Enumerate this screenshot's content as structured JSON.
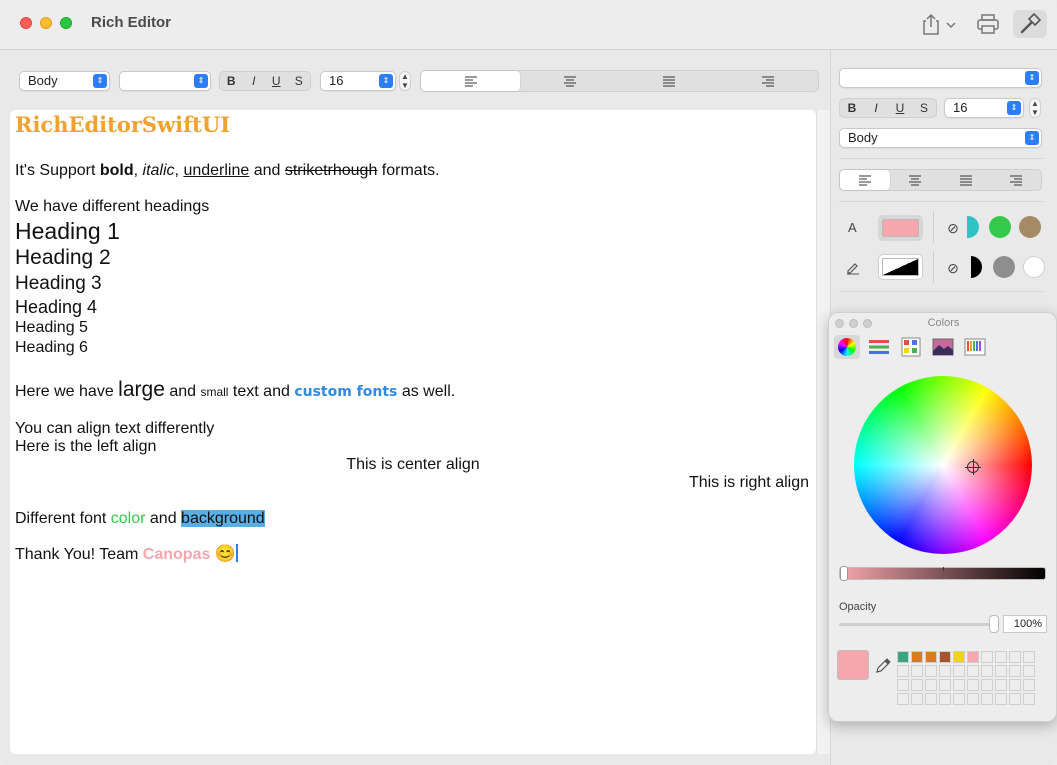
{
  "window": {
    "title": "Rich Editor"
  },
  "toolbar": {
    "style_popup": "Body",
    "font_popup": "",
    "bold": "B",
    "italic": "I",
    "underline": "U",
    "strike": "S",
    "size": "16",
    "align": [
      "left",
      "center",
      "justify",
      "right"
    ],
    "selected_align": "left"
  },
  "editor": {
    "title": "RichEditorSwiftUI",
    "support_prefix": "It's Support ",
    "bold_word": "bold",
    "comma1": ", ",
    "italic_word": "italic",
    "comma2": ", ",
    "underline_word": "underline",
    "and1": " and ",
    "strike_word": "striketrhough",
    "formats_suffix": " formats.",
    "headings_intro": "We have different headings",
    "headings": [
      "Heading 1",
      "Heading 2",
      "Heading 3",
      "Heading 4",
      "Heading 5",
      "Heading 6"
    ],
    "size_prefix": "Here we have ",
    "large_word": "large",
    "and2": " and ",
    "small_word": "small",
    "text_and": " text and ",
    "custom_fonts": "custom fonts",
    "as_well": " as well.",
    "align_intro": "You can align text differently",
    "left_align": "Here is the left align",
    "center_align": "This is center align",
    "right_align": "This is right align",
    "diff_font": "Different font ",
    "color_word": "color",
    "and3": " and ",
    "background_word": "background",
    "thanks": "Thank You! Team ",
    "canopas": "Canopas",
    "emoji": "😊"
  },
  "inspector": {
    "font_popup": "",
    "bold": "B",
    "italic": "I",
    "underline": "U",
    "strike": "S",
    "size": "16",
    "style_popup": "Body",
    "text_color_label": "A",
    "text_color": "#f6a6ad",
    "quick_colors_text": [
      "#2ec4c4",
      "#34c94a",
      "#a58a66"
    ],
    "quick_colors_bg": [
      "#000000",
      "#8e8e8e",
      "#ffffff"
    ]
  },
  "colors_panel": {
    "title": "Colors",
    "opacity_label": "Opacity",
    "opacity_value": "100%",
    "current_color": "#f6a6ad",
    "swatches": [
      "#3aa37f",
      "#d97b25",
      "#d97b25",
      "#a4552d",
      "#f2d21a",
      "#f6a6ad"
    ]
  }
}
